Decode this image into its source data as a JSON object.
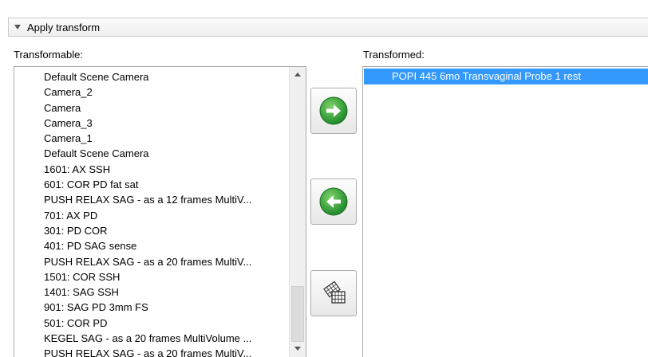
{
  "section": {
    "title": "Apply transform"
  },
  "transformable": {
    "label": "Transformable:",
    "items": [
      "Default Scene Camera",
      "Camera_2",
      "Camera",
      "Camera_3",
      "Camera_1",
      "Default Scene Camera",
      "1601: AX SSH",
      "601: COR PD fat sat",
      "PUSH RELAX SAG - as a 12 frames MultiV...",
      "701: AX PD",
      "301: PD COR",
      "401: PD SAG sense",
      "PUSH RELAX SAG - as a 20 frames MultiV...",
      "1501: COR SSH",
      "1401: SAG SSH",
      "901: SAG PD 3mm FS",
      "501: COR PD",
      "KEGEL SAG - as a 20 frames MultiVolume ...",
      "PUSH RELAX SAG - as a 20 frames MultiV..."
    ]
  },
  "transformed": {
    "label": "Transformed:",
    "items": [
      "POPI 445 6mo Transvaginal Probe 1 rest"
    ]
  },
  "colors": {
    "selection": "#3399ff",
    "arrow_green": "#2e9e2e"
  },
  "icons": {
    "move_right": "arrow-right-circle-icon",
    "move_left": "arrow-left-circle-icon",
    "harden": "harden-transform-icon"
  }
}
